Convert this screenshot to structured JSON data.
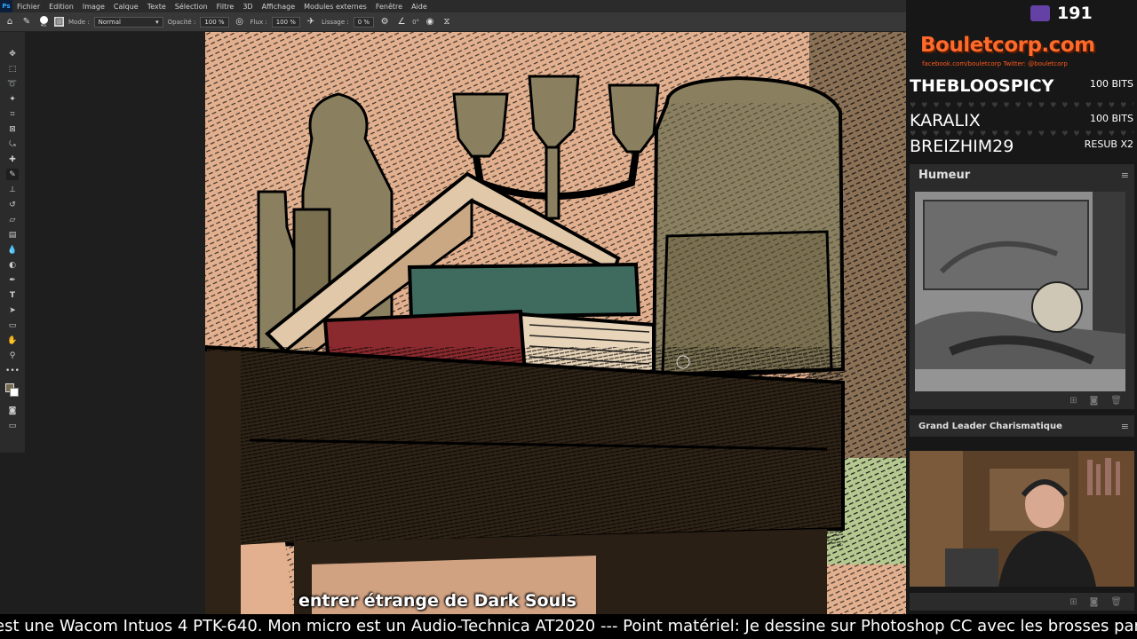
{
  "menubar": {
    "logo": "Ps",
    "items": [
      "Fichier",
      "Edition",
      "Image",
      "Calque",
      "Texte",
      "Sélection",
      "Filtre",
      "3D",
      "Affichage",
      "Modules externes",
      "Fenêtre",
      "Aide"
    ]
  },
  "options": {
    "brush_size": "45",
    "mode_label": "Mode :",
    "mode_value": "Normal",
    "opacity_label": "Opacité :",
    "opacity_value": "100 %",
    "flow_label": "Flux :",
    "flow_value": "100 %",
    "smoothing_label": "Lissage :",
    "smoothing_value": "0 %",
    "angle_value": "0°"
  },
  "tools": {
    "icons": [
      "move-icon",
      "marquee-icon",
      "lasso-icon",
      "magic-wand-icon",
      "crop-icon",
      "frame-icon",
      "eyedropper-icon",
      "healing-icon",
      "brush-icon",
      "stamp-icon",
      "history-brush-icon",
      "eraser-icon",
      "gradient-icon",
      "blur-icon",
      "dodge-icon",
      "pen-icon",
      "type-icon",
      "path-select-icon",
      "rectangle-icon",
      "hand-icon",
      "zoom-icon",
      "more-icon"
    ],
    "foreground_color": "#746a4e",
    "background_color": "#ffffff"
  },
  "canvas": {
    "subtitle": "entrer étrange de Dark Souls"
  },
  "stream": {
    "bits_count": "191",
    "brand": "Bouletcorp.com",
    "brand_sub": "facebook.com/bouletcorp   Twitter: @bouletcorp",
    "alerts": [
      {
        "name": "THEBLOOSPICY",
        "value": "100 BITS"
      },
      {
        "name": "KARALIX",
        "value": "100 BITS"
      },
      {
        "name": "BREIZHIM29",
        "value": "RESUB X2"
      }
    ],
    "mood_panel_title": "Humeur",
    "leader_panel_title": "Grand Leader Charismatique",
    "ticker": "est une Wacom Intuos 4 PTK-640. Mon micro est un Audio-Technica AT2020 ---  Point matériel: Je dessine sur Photoshop CC avec les brosses par défaut"
  },
  "colors": {
    "brand_orange": "#ff6a2a",
    "twitch_purple": "#6441a5",
    "panel_bg": "#2b2b2b"
  }
}
